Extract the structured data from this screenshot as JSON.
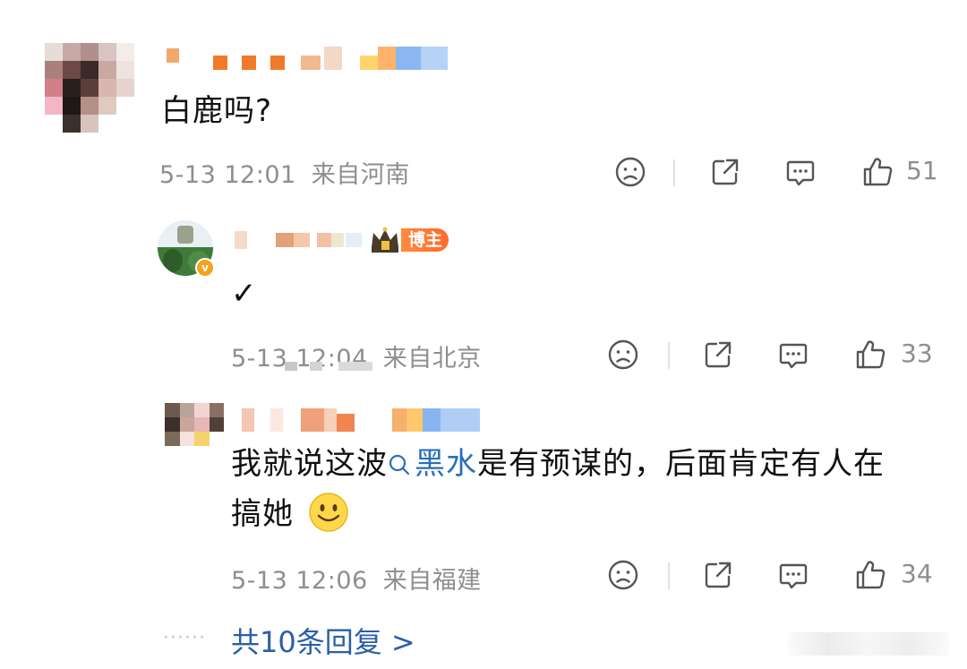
{
  "comments": [
    {
      "text": "白鹿吗?",
      "time": "5-13 12:01",
      "location": "来自河南",
      "likes": "51"
    },
    {
      "text": "✓",
      "time": "5-13 12:04",
      "location": "来自北京",
      "likes": "33",
      "badge": "博主"
    },
    {
      "text_before": "我就说这波",
      "topic": "黑水",
      "text_after": "是有预谋的，后面肯定有人在",
      "text_line2": "搞她",
      "time": "5-13 12:06",
      "location": "来自福建",
      "likes": "34"
    }
  ],
  "replies": {
    "dots": "······",
    "label": "共10条回复 >"
  },
  "icons": {
    "dislike": "frown-face-icon",
    "share": "share-icon",
    "reply": "comment-icon",
    "like": "thumbs-up-icon",
    "topic": "search-icon",
    "emoji": "smile-emoji-icon"
  },
  "colors": {
    "link": "#2a5fa8",
    "badge": "#ff7a33",
    "meta": "#8e8e8e"
  }
}
